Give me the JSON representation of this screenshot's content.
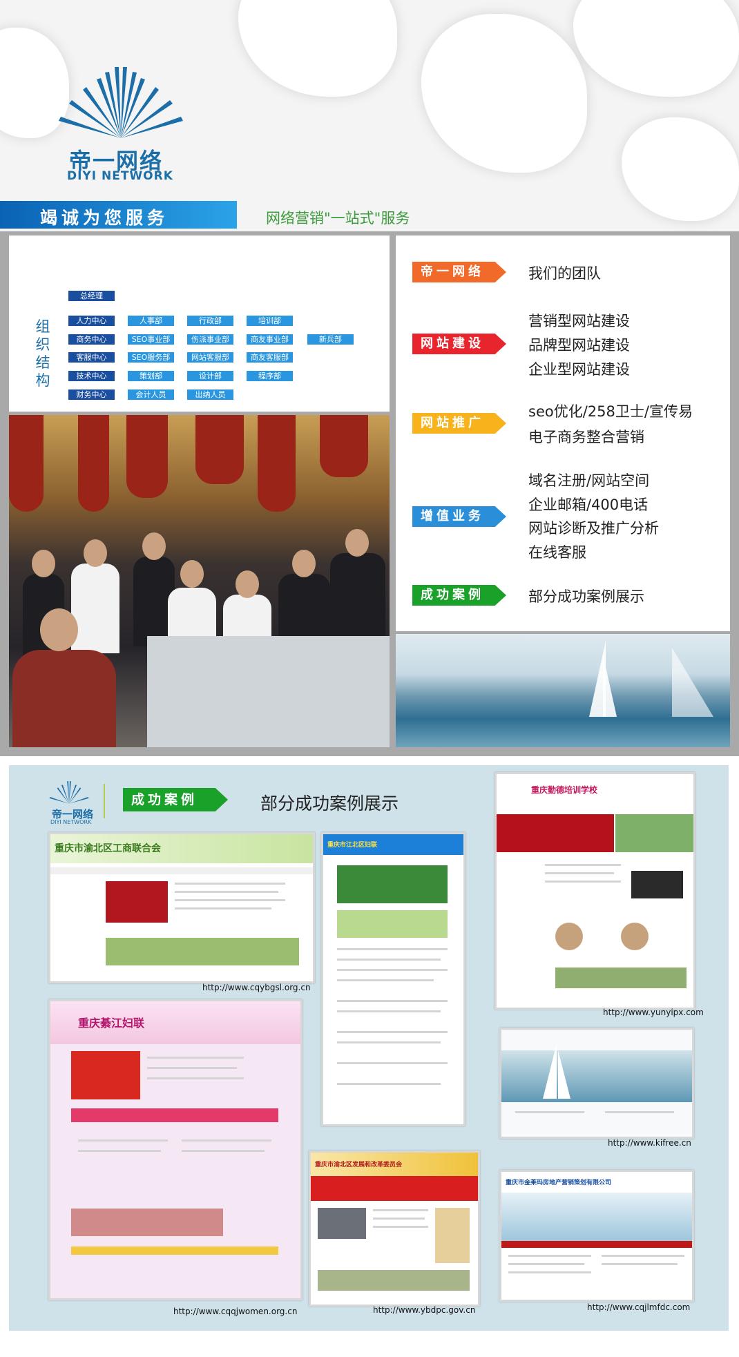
{
  "brand": {
    "name_cn": "帝一网络",
    "name_en": "DIYI NETWORK",
    "slogan": "竭诚为您服务",
    "tagline": "网络营销\"一站式\"服务",
    "primary_color": "#1b6ea8"
  },
  "org_chart": {
    "title": "组织结构",
    "top": "总经理",
    "rows": [
      [
        "人力中心",
        "人事部",
        "行政部",
        "培训部"
      ],
      [
        "商务中心",
        "SEO事业部",
        "伤派事业部",
        "商友事业部",
        "新兵部"
      ],
      [
        "客服中心",
        "SEO服务部",
        "网站客服部",
        "商友客服部"
      ],
      [
        "技术中心",
        "策划部",
        "设计部",
        "程序部"
      ],
      [
        "财务中心",
        "会计人员",
        "出纳人员"
      ]
    ]
  },
  "services": [
    {
      "tag": "帝一网络",
      "color": "#f26a2a",
      "lines": [
        "我们的团队"
      ]
    },
    {
      "tag": "网站建设",
      "color": "#e8242c",
      "lines": [
        "营销型网站建设",
        "品牌型网站建设",
        "企业型网站建设"
      ]
    },
    {
      "tag": "网站推广",
      "color": "#f7b21c",
      "lines": [
        "seo优化/258卫士/宣传易",
        "电子商务整合营销"
      ]
    },
    {
      "tag": "增值业务",
      "color": "#2a8fd8",
      "lines": [
        "域名注册/网站空间",
        "企业邮箱/400电话",
        "网站诊断及推广分析",
        "在线客服"
      ]
    },
    {
      "tag": "成功案例",
      "color": "#19a12a",
      "lines": [
        "部分成功案例展示"
      ]
    }
  ],
  "cases": {
    "tag": "成功案例",
    "heading": "部分成功案例展示",
    "sites": [
      {
        "title": "重庆市渝北区工商联合会",
        "url": "http://www.cqybgsl.org.cn"
      },
      {
        "title": "重庆市江北区妇联",
        "url": ""
      },
      {
        "title": "重庆勤德培训学校",
        "url": "http://www.yunyipx.com"
      },
      {
        "title": "重庆綦江妇联",
        "url": "http://www.cqqjwomen.org.cn"
      },
      {
        "title": "",
        "url": "http://www.kifree.cn"
      },
      {
        "title": "重庆市渝北区发展和改革委员会",
        "url": "http://www.ybdpc.gov.cn"
      },
      {
        "title": "重庆市金莱玛房地产营销策划有限公司",
        "url": "http://www.cqjlmfdc.com"
      }
    ]
  }
}
